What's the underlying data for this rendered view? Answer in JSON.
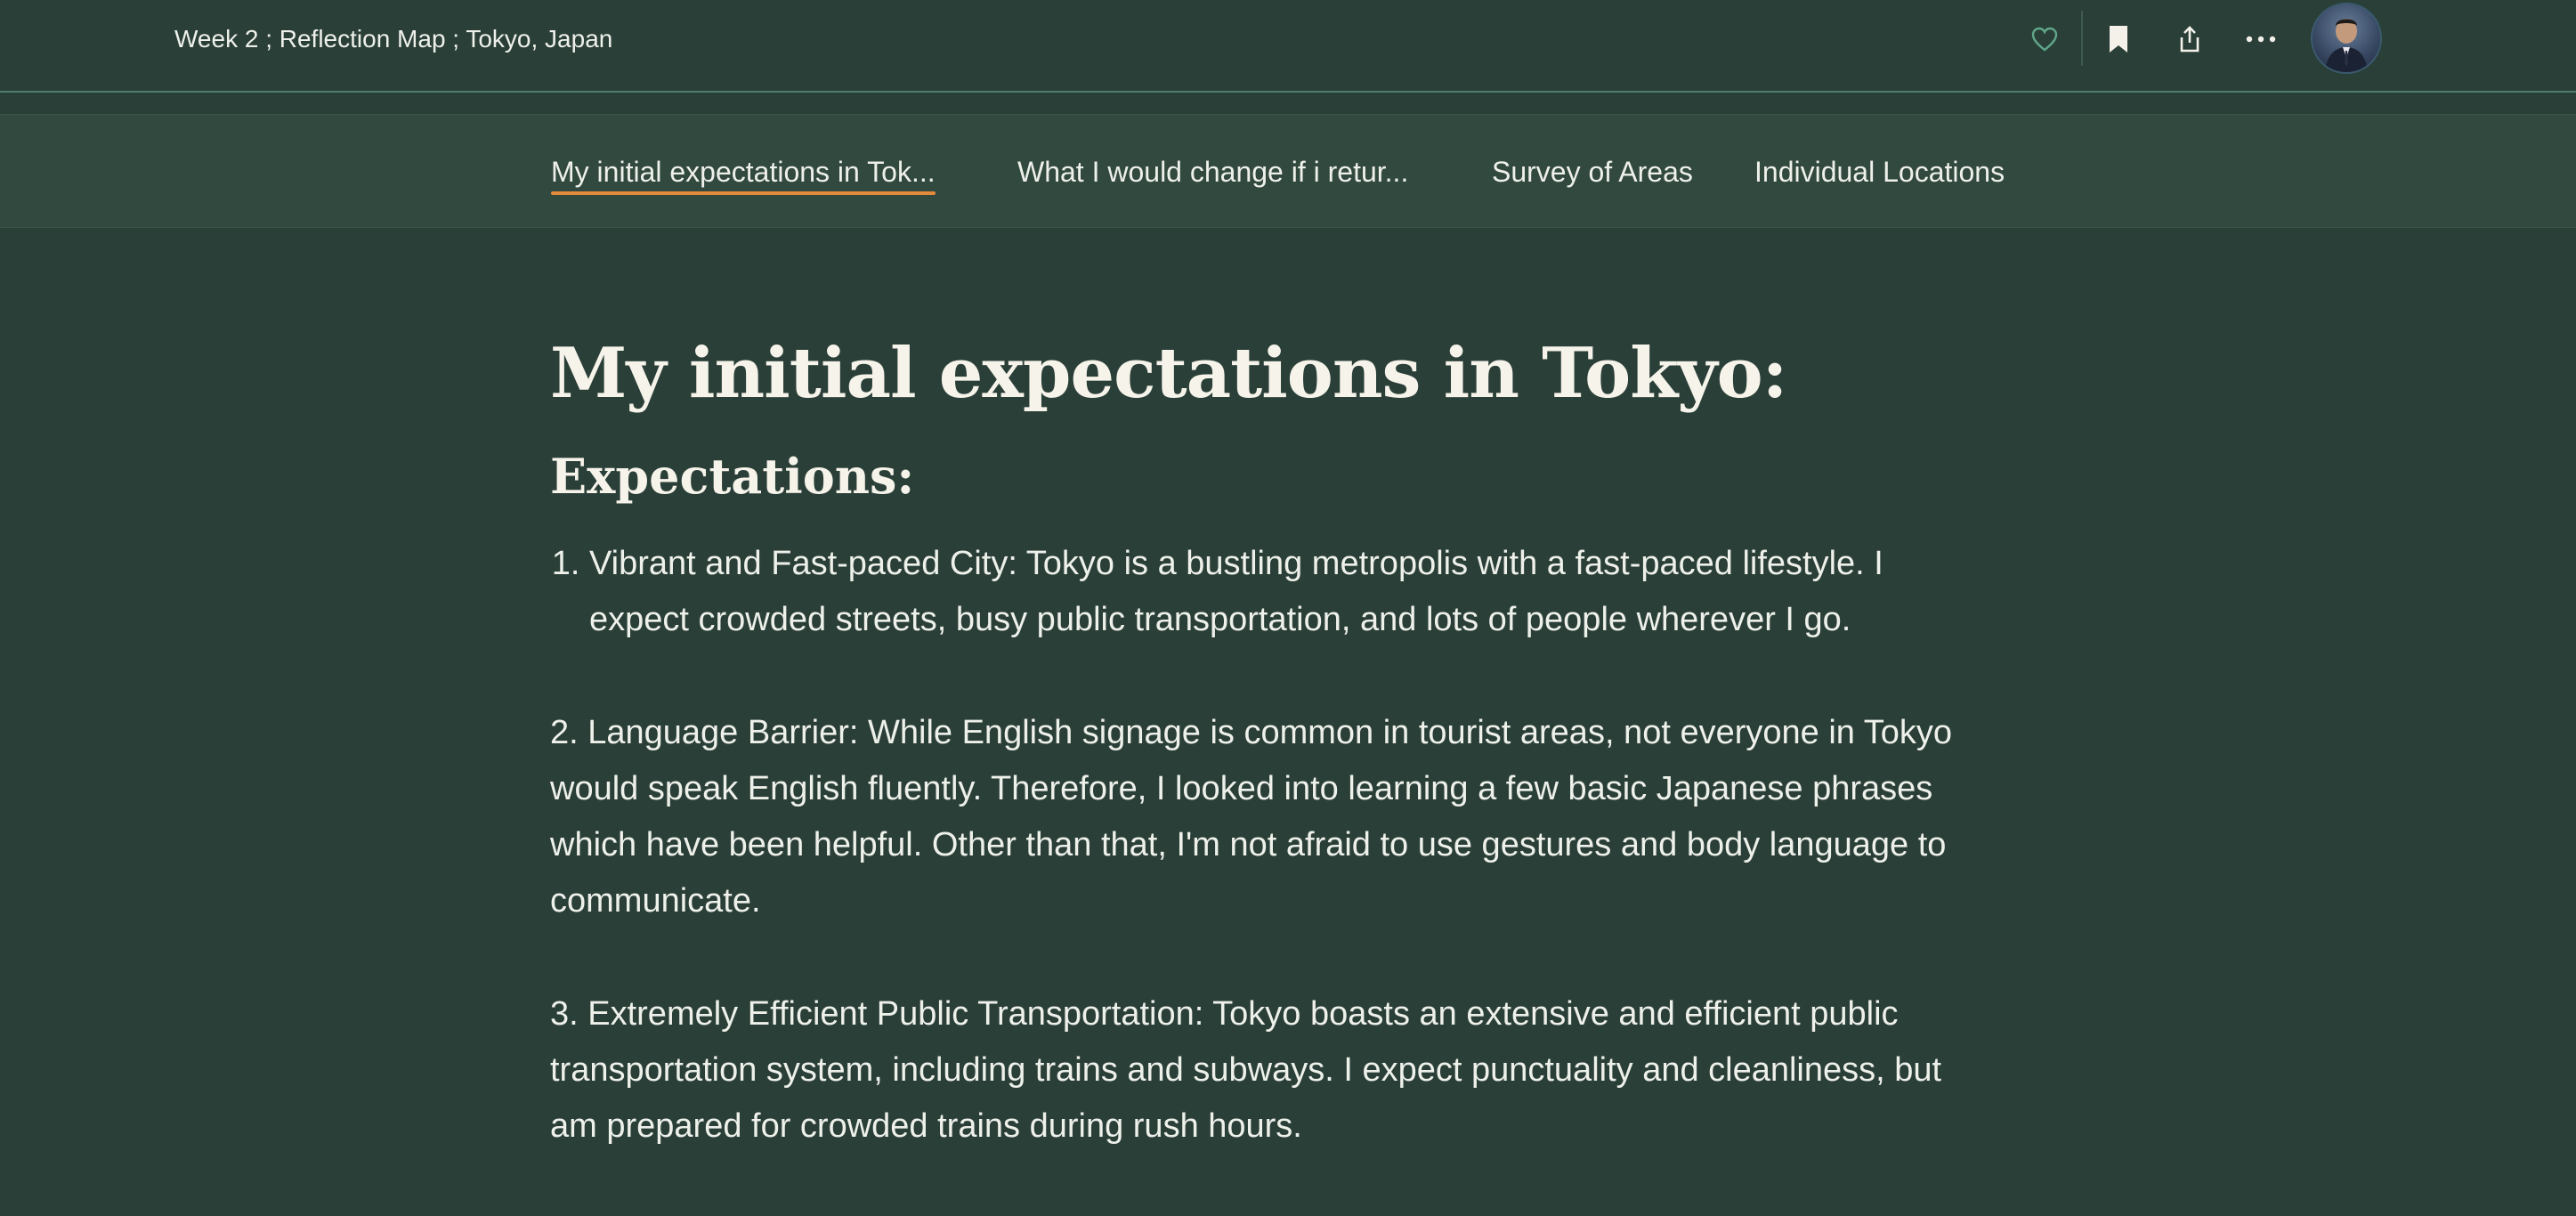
{
  "header": {
    "story_title": "Week 2 ; Reflection Map ; Tokyo, Japan",
    "actions": [
      "heart-icon",
      "bookmark-icon",
      "share-icon",
      "more-icon"
    ],
    "avatar": "user-avatar"
  },
  "nav": {
    "tabs": [
      {
        "label": "My initial expectations in Tok...",
        "active": true
      },
      {
        "label": "What I would change if i retur...",
        "active": false
      },
      {
        "label": "Survey of Areas",
        "active": false
      },
      {
        "label": "Individual Locations",
        "active": false
      }
    ]
  },
  "main": {
    "heading": "My initial expectations in Tokyo:",
    "subheading": "Expectations:",
    "item1": "Vibrant and Fast-paced City: Tokyo is a bustling metropolis with a fast-paced lifestyle. I expect crowded streets, busy public transportation, and lots of people wherever I go.",
    "item2": "2. Language Barrier: While English signage is common in tourist areas, not everyone in Tokyo would speak English fluently. Therefore, I looked into learning a few basic Japanese phrases which have been helpful. Other than that, I'm not afraid to use gestures and body language to communicate.",
    "item3": "3. Extremely Efficient Public Transportation: Tokyo boasts an extensive and efficient public transportation system, including trains and subways. I expect punctuality and cleanliness, but am prepared for crowded trains during rush hours."
  },
  "colors": {
    "background": "#2a3f38",
    "nav_background": "#32493f",
    "active_underline": "#e48a3c",
    "heart_accent": "#5fa68a"
  }
}
